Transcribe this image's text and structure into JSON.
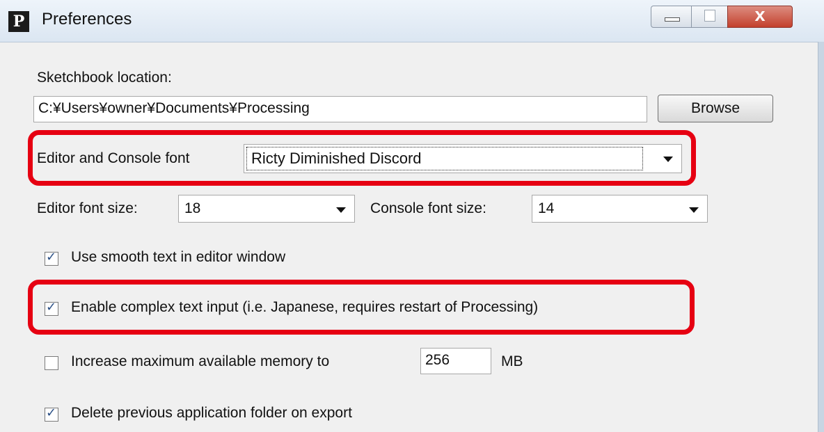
{
  "window": {
    "title": "Preferences",
    "app_icon_letter": "P",
    "close_symbol": "x"
  },
  "sketchbook": {
    "label": "Sketchbook location:",
    "path": "C:¥Users¥owner¥Documents¥Processing",
    "browse_label": "Browse"
  },
  "fonts": {
    "editor_console_label": "Editor and Console font",
    "editor_console_value": "Ricty Diminished Discord",
    "editor_size_label": "Editor font size:",
    "editor_size_value": "18",
    "console_size_label": "Console font size:",
    "console_size_value": "14"
  },
  "options": {
    "smooth_text_label": "Use smooth text in editor window",
    "smooth_text_checked": true,
    "complex_input_label": "Enable complex text input (i.e. Japanese, requires restart of Processing)",
    "complex_input_checked": true,
    "memory_label": "Increase maximum available memory to",
    "memory_checked": false,
    "memory_value": "256",
    "memory_unit": "MB",
    "delete_folder_label": "Delete previous application folder on export",
    "delete_folder_checked": true
  },
  "colors": {
    "highlight": "#e60012",
    "checkmark": "#2a4f85"
  },
  "icons": {
    "app": "processing-app-icon",
    "minimize": "minimize-icon",
    "maximize": "maximize-icon",
    "close": "close-icon",
    "dropdown": "chevron-down-icon",
    "check": "checkmark-icon"
  }
}
